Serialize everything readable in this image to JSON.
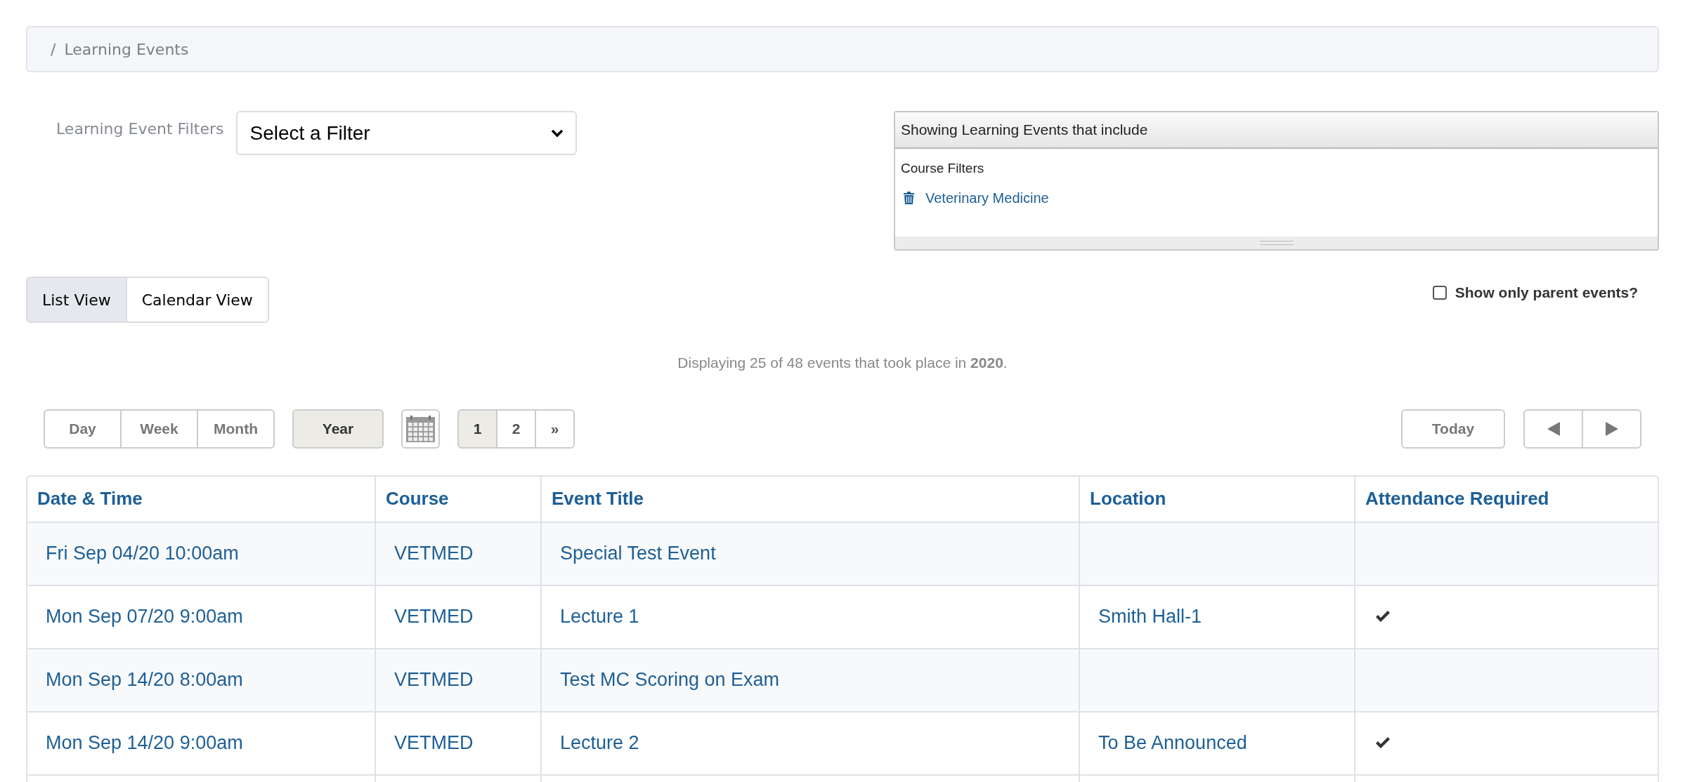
{
  "breadcrumb": {
    "separator": "/",
    "current": "Learning Events"
  },
  "filter_bar": {
    "label": "Learning Event Filters",
    "select_value": "Select a Filter"
  },
  "filter_panel": {
    "title": "Showing Learning Events that include",
    "sections": [
      {
        "heading": "Course Filters",
        "items": [
          {
            "label": "Veterinary Medicine"
          }
        ]
      }
    ]
  },
  "view_toggle": [
    {
      "label": "List View",
      "selected": true
    },
    {
      "label": "Calendar View",
      "selected": false
    }
  ],
  "parent_only": {
    "label": "Show only parent events?",
    "checked": false
  },
  "summary": "Displaying 25 of 48 events that took place in **2020**.",
  "periods": [
    {
      "label": "Day",
      "kind": "grouped",
      "selected": false
    },
    {
      "label": "Week",
      "kind": "grouped",
      "selected": false
    },
    {
      "label": "Month",
      "kind": "grouped",
      "selected": false
    },
    {
      "label": "Year",
      "kind": "standalone",
      "selected": true
    }
  ],
  "pages": [
    {
      "label": "1",
      "selected": true
    },
    {
      "label": "2",
      "selected": false
    },
    {
      "label": "»",
      "selected": false
    }
  ],
  "today_button": "Today",
  "table": {
    "columns": [
      "Date & Time",
      "Course",
      "Event Title",
      "Location",
      "Attendance Required"
    ],
    "rows": [
      {
        "date": "Fri Sep 04/20 10:00am",
        "course": "VETMED",
        "title": "Special Test Event",
        "attendance_required": false
      },
      {
        "date": "Mon Sep 07/20 9:00am",
        "course": "VETMED",
        "title": "Lecture 1",
        "location": "Smith Hall-1",
        "attendance_required": true
      },
      {
        "date": "Mon Sep 14/20 8:00am",
        "course": "VETMED",
        "title": "Test MC Scoring on Exam",
        "attendance_required": false
      },
      {
        "date": "Mon Sep 14/20 9:00am",
        "course": "VETMED",
        "title": "Lecture 2",
        "location": "To Be Announced",
        "attendance_required": true
      }
    ]
  }
}
